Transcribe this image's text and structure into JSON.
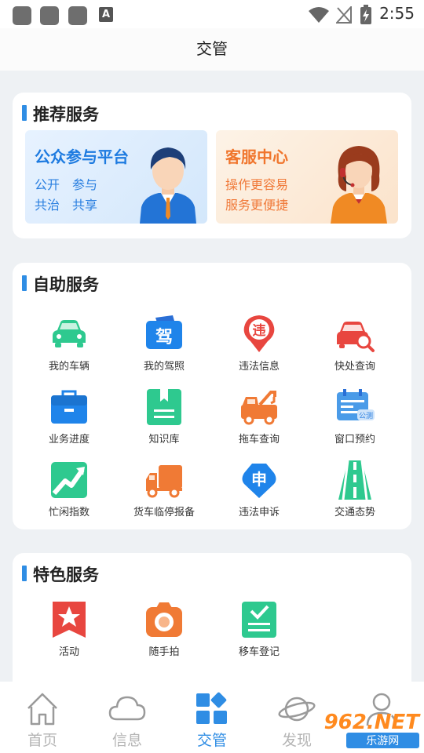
{
  "status": {
    "time": "2:55",
    "a_badge": "A"
  },
  "header": {
    "title": "交管"
  },
  "recommended": {
    "title": "推荐服务",
    "public": {
      "title": "公众参与平台",
      "line1": "公开　参与",
      "line2": "共治　共享"
    },
    "support": {
      "title": "客服中心",
      "line1": "操作更容易",
      "line2": "服务更便捷"
    }
  },
  "self_service": {
    "title": "自助服务",
    "items": [
      {
        "label": "我的车辆",
        "icon": "car-icon"
      },
      {
        "label": "我的驾照",
        "icon": "license-icon"
      },
      {
        "label": "违法信息",
        "icon": "violation-pin-icon"
      },
      {
        "label": "快处查询",
        "icon": "car-search-icon"
      },
      {
        "label": "业务进度",
        "icon": "briefcase-icon"
      },
      {
        "label": "知识库",
        "icon": "book-icon"
      },
      {
        "label": "拖车查询",
        "icon": "tow-truck-icon"
      },
      {
        "label": "窗口预约",
        "icon": "calendar-icon"
      },
      {
        "label": "忙闲指数",
        "icon": "trend-icon"
      },
      {
        "label": "货车临停报备",
        "icon": "truck-icon"
      },
      {
        "label": "违法申诉",
        "icon": "appeal-icon"
      },
      {
        "label": "交通态势",
        "icon": "road-icon"
      }
    ],
    "calendar_badge": "公测",
    "license_glyph": "驾",
    "violation_glyph": "违",
    "appeal_glyph": "申"
  },
  "featured": {
    "title": "特色服务",
    "items": [
      {
        "label": "活动",
        "icon": "star-bookmark-icon"
      },
      {
        "label": "随手拍",
        "icon": "camera-icon"
      },
      {
        "label": "移车登记",
        "icon": "checklist-icon"
      }
    ]
  },
  "tabs": [
    {
      "label": "首页",
      "icon": "home-icon"
    },
    {
      "label": "信息",
      "icon": "cloud-icon"
    },
    {
      "label": "交管",
      "icon": "grid-icon",
      "active": true
    },
    {
      "label": "发现",
      "icon": "planet-icon"
    },
    {
      "label": "我的",
      "icon": "user-icon"
    }
  ],
  "watermark": {
    "text": "962.NET",
    "sub": "乐游网"
  },
  "colors": {
    "accent": "#2f8de4",
    "orange": "#f0752c",
    "background": "#eef1f4"
  }
}
